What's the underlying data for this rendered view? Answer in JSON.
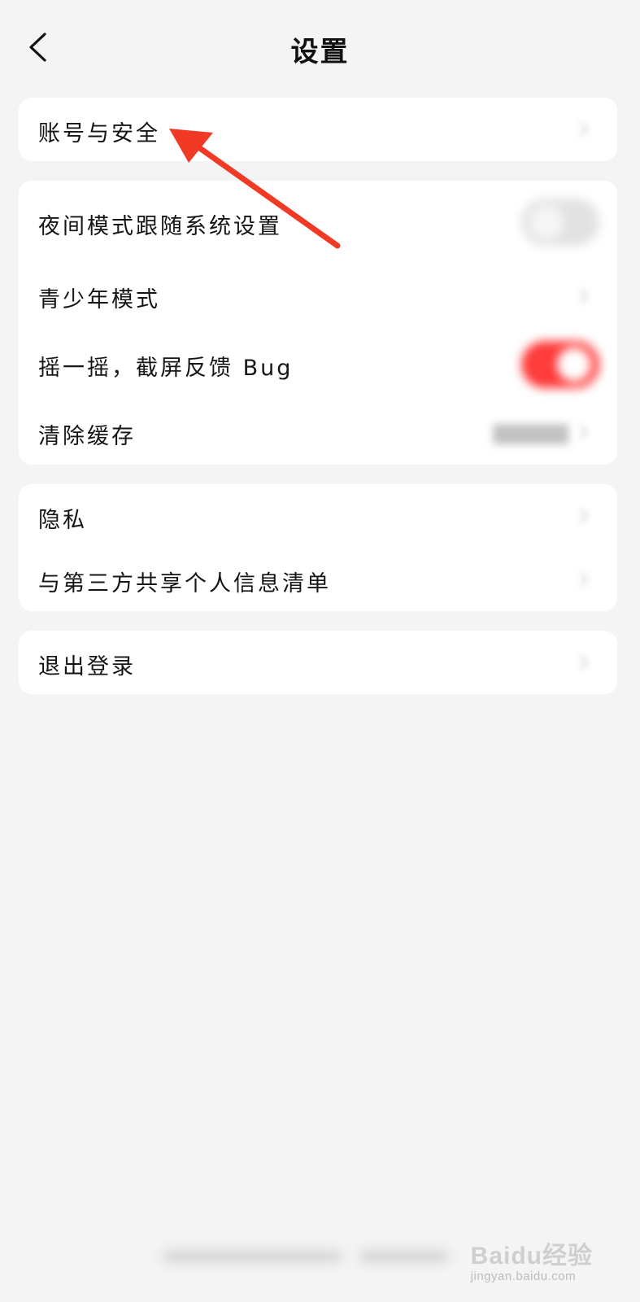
{
  "header": {
    "title": "设置",
    "back_icon": "chevron-left-icon"
  },
  "groups": [
    {
      "items": [
        {
          "label": "账号与安全",
          "control": "chevron"
        }
      ]
    },
    {
      "items": [
        {
          "label": "夜间模式跟随系统设置",
          "control": "toggle",
          "enabled": false
        },
        {
          "label": "青少年模式",
          "control": "chevron"
        },
        {
          "label": "摇一摇，截屏反馈 Bug",
          "control": "toggle",
          "enabled": true
        },
        {
          "label": "清除缓存",
          "control": "value-chevron"
        }
      ]
    },
    {
      "items": [
        {
          "label": "隐私",
          "control": "chevron"
        },
        {
          "label": "与第三方共享个人信息清单",
          "control": "chevron"
        }
      ]
    },
    {
      "items": [
        {
          "label": "退出登录",
          "control": "chevron"
        }
      ]
    }
  ],
  "annotation": {
    "icon": "red-arrow-annotation",
    "color": "#f03a25"
  },
  "watermark": {
    "main": "Baidu经验",
    "sub": "jingyan.baidu.com"
  },
  "colors": {
    "background": "#f4f4f4",
    "card": "#ffffff",
    "accent": "#ff3b3b"
  }
}
